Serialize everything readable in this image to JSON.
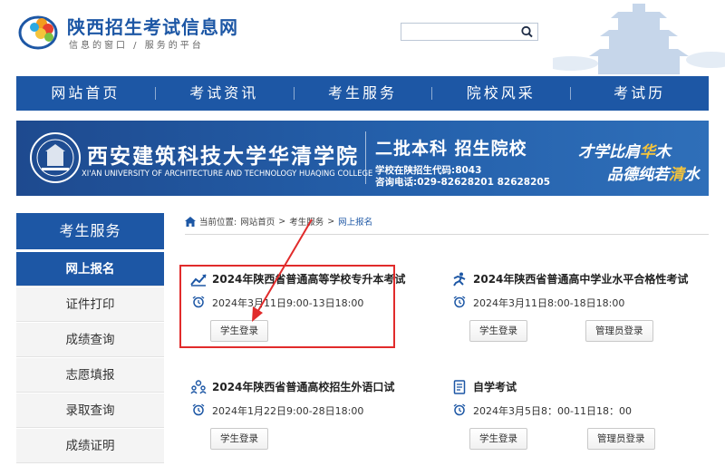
{
  "header": {
    "title": "陕西招生考试信息网",
    "slogan": "信息的窗口 / 服务的平台",
    "search": {
      "value": "",
      "placeholder": ""
    }
  },
  "nav": [
    "网站首页",
    "考试资讯",
    "考生服务",
    "院校风采",
    "考试历"
  ],
  "banner": {
    "school_cn": "西安建筑科技大学华清学院",
    "school_en": "XI'AN UNIVERSITY OF ARCHITECTURE AND TECHNOLOGY HUAQING COLLEGE",
    "tag": "二批本科 招生院校",
    "code_line": "学校在陕招生代码:8043",
    "phone_line": "咨询电话:029-82628201 82628205",
    "motto1_a": "才学比肩",
    "motto1_b": "华",
    "motto1_c": "木",
    "motto2_a": "品德纯若",
    "motto2_b": "清",
    "motto2_c": "水"
  },
  "sidebar": {
    "heading": "考生服务",
    "items": [
      "网上报名",
      "证件打印",
      "成绩查询",
      "志愿填报",
      "录取查询",
      "成绩证明"
    ]
  },
  "breadcrumb": {
    "prefix": "当前位置:",
    "home": "网站首页",
    "sep1": ">",
    "section": "考生服务",
    "sep2": ">",
    "current": "网上报名"
  },
  "exams": [
    {
      "title": "2024年陕西省普通高等学校专升本考试",
      "date": "2024年3月11日9:00-13日18:00",
      "buttons": [
        "学生登录"
      ]
    },
    {
      "title": "2024年陕西省普通高中学业水平合格性考试",
      "date": "2024年3月11日8:00-18日18:00",
      "buttons": [
        "学生登录",
        "管理员登录"
      ]
    },
    {
      "title": "2024年陕西省普通高校招生外语口试",
      "date": "2024年1月22日9:00-28日18:00",
      "buttons": [
        "学生登录"
      ]
    },
    {
      "title": "自学考试",
      "date": "2024年3月5日8：00-11日18：00",
      "buttons": [
        "学生登录",
        "管理员登录"
      ]
    }
  ],
  "colors": {
    "brand": "#1d57a5",
    "highlight": "#e12b2b",
    "accent": "#f5c43b"
  },
  "icons": {
    "logo": "flower-logo-icon",
    "search": "search-icon",
    "exam1": "trend-chart-icon",
    "exam2": "runner-icon",
    "exam3": "people-group-icon",
    "exam4": "document-icon",
    "time": "alarm-clock-icon"
  }
}
